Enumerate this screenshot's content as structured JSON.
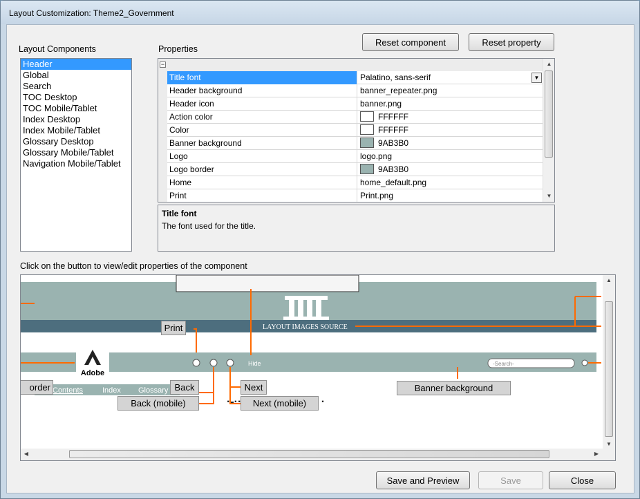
{
  "window": {
    "title": "Layout Customization: Theme2_Government"
  },
  "components": {
    "label": "Layout Components",
    "items": [
      "Header",
      "Global",
      "Search",
      "TOC Desktop",
      "TOC Mobile/Tablet",
      "Index Desktop",
      "Index Mobile/Tablet",
      "Glossary Desktop",
      "Glossary Mobile/Tablet",
      "Navigation Mobile/Tablet"
    ],
    "selected": "Header"
  },
  "properties": {
    "label": "Properties",
    "rows": [
      {
        "name": "Title font",
        "value": "Palatino, sans-serif"
      },
      {
        "name": "Header background",
        "value": "banner_repeater.png"
      },
      {
        "name": "Header icon",
        "value": "banner.png"
      },
      {
        "name": "Action color",
        "value": "FFFFFF",
        "swatch": "#FFFFFF"
      },
      {
        "name": "Color",
        "value": "FFFFFF",
        "swatch": "#FFFFFF"
      },
      {
        "name": "Banner background",
        "value": "9AB3B0",
        "swatch": "#9AB3B0"
      },
      {
        "name": "Logo",
        "value": "logo.png"
      },
      {
        "name": "Logo border",
        "value": "9AB3B0",
        "swatch": "#9AB3B0"
      },
      {
        "name": "Home",
        "value": "home_default.png"
      },
      {
        "name": "Print",
        "value": "Print.png"
      }
    ],
    "description_title": "Title font",
    "description_text": "The font used for the title."
  },
  "toolbar": {
    "reset_component": "Reset component",
    "reset_property": "Reset property"
  },
  "preview": {
    "label": "Click on the button to view/edit properties of the component",
    "banner_text": "LAYOUT IMAGES SOURCE",
    "logo_text": "Adobe",
    "hide_text": "Hide",
    "search_placeholder": "-Search-",
    "nav_tabs": [
      "Contents",
      "Index",
      "Glossary"
    ],
    "callouts": {
      "print": "Print",
      "back": "Back",
      "back_mobile": "Back (mobile)",
      "next": "Next",
      "next_mobile": "Next (mobile)",
      "banner_background": "Banner background",
      "logo_border": "order"
    },
    "colors": {
      "banner_dark": "#4d6e7e",
      "banner_light": "#9ab3b0",
      "callout_line": "#ff6a00"
    }
  },
  "footer": {
    "save_preview": "Save and Preview",
    "save": "Save",
    "close": "Close"
  }
}
